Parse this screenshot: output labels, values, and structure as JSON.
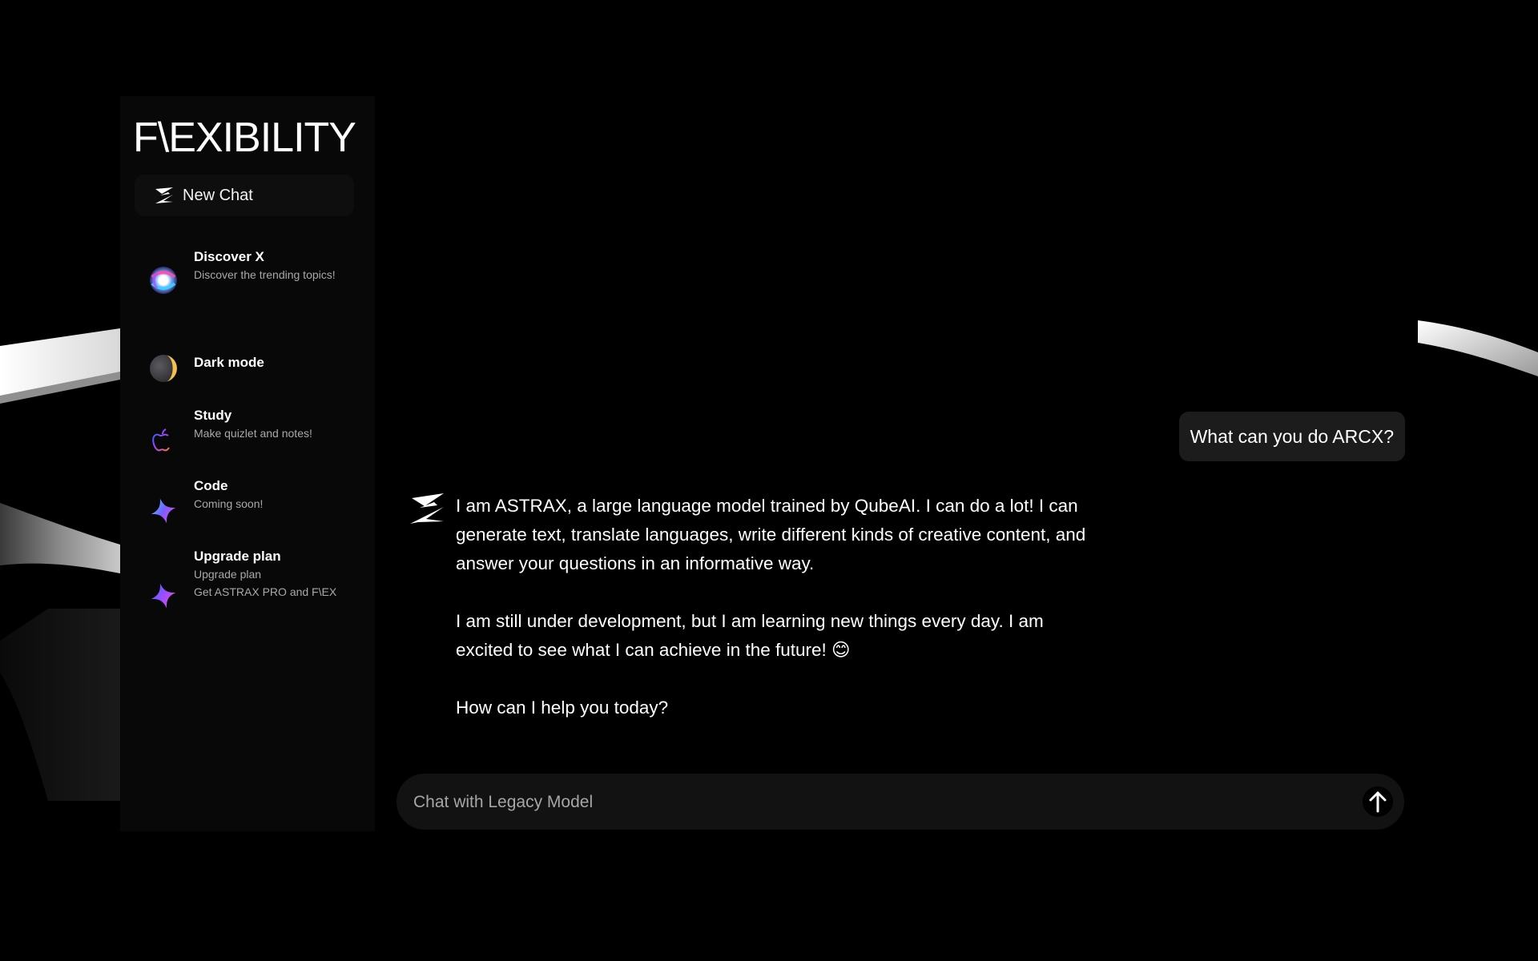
{
  "app": {
    "logo_text": "F\\EXIBILITY"
  },
  "sidebar": {
    "new_chat_label": "New Chat",
    "new_chat_icon": "astrax-logo-icon",
    "items": [
      {
        "title": "Discover X",
        "description": "Discover the trending topics!",
        "icon": "discover-orb-icon"
      },
      {
        "title": "Dark mode",
        "description": "",
        "icon": "moon-icon"
      },
      {
        "title": "Study",
        "description": "Make quizlet and notes!",
        "icon": "apple-logo-icon"
      },
      {
        "title": "Code",
        "description": "Coming soon!",
        "icon": "sparkle-icon"
      },
      {
        "title": "Upgrade plan",
        "description": "Upgrade plan",
        "description2": "Get ASTRAX PRO and F\\EX",
        "icon": "sparkle-icon"
      }
    ]
  },
  "chat": {
    "user_message": "What can you do ARCX?",
    "bot_avatar_icon": "astrax-logo-icon",
    "bot_paragraphs": [
      "I am ASTRAX, a large language model trained by QubeAI. I can do a lot! I can generate text, translate languages, write different kinds of creative content, and answer your questions in an informative way.",
      "I am still under development, but I am learning new things every day. I am excited to see what I can achieve in the future! 😊",
      "How can I help you today?"
    ]
  },
  "composer": {
    "placeholder": "Chat with Legacy Model",
    "value": "",
    "send_icon": "arrow-up-icon"
  },
  "colors": {
    "background": "#000000",
    "sidebar": "#080808",
    "bubble": "#1c1c1c",
    "composer": "#121212",
    "muted_text": "#a9a9a9"
  }
}
